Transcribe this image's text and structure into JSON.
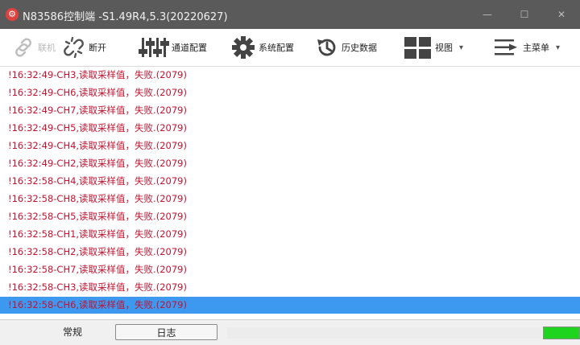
{
  "window": {
    "title": "N83586控制端 -S1.49R4,5.3(20220627)",
    "app_icon": "app-logo-icon",
    "controls": [
      "minimize-icon",
      "maximize-icon",
      "close-icon"
    ]
  },
  "toolbar": {
    "items": [
      {
        "label": "联机",
        "icon": "link-icon",
        "enabled": false
      },
      {
        "label": "断开",
        "icon": "disconnect-icon",
        "enabled": true
      },
      {
        "label": "通道配置",
        "icon": "channel-sliders-icon",
        "enabled": true
      },
      {
        "label": "系统配置",
        "icon": "gear-icon",
        "enabled": true
      },
      {
        "label": "历史数据",
        "icon": "history-clock-icon",
        "enabled": true
      },
      {
        "label": "视图",
        "icon": "grid-view-icon",
        "enabled": true,
        "dropdown": true
      },
      {
        "label": "主菜单",
        "icon": "main-menu-icon",
        "enabled": true,
        "dropdown": true
      }
    ]
  },
  "log": {
    "entries": [
      "!16:32:49-CH3,读取采样值，失败.(2079)",
      "!16:32:49-CH6,读取采样值，失败.(2079)",
      "!16:32:49-CH7,读取采样值，失败.(2079)",
      "!16:32:49-CH5,读取采样值，失败.(2079)",
      "!16:32:49-CH4,读取采样值，失败.(2079)",
      "!16:32:49-CH2,读取采样值，失败.(2079)",
      "!16:32:58-CH4,读取采样值，失败.(2079)",
      "!16:32:58-CH8,读取采样值，失败.(2079)",
      "!16:32:58-CH5,读取采样值，失败.(2079)",
      "!16:32:58-CH1,读取采样值，失败.(2079)",
      "!16:32:58-CH2,读取采样值，失败.(2079)",
      "!16:32:58-CH7,读取采样值，失败.(2079)",
      "!16:32:58-CH3,读取采样值，失败.(2079)",
      "!16:32:58-CH6,读取采样值，失败.(2079)"
    ],
    "selected_index": 13,
    "text_color": "#c4122f",
    "selection_color": "#3d99f0"
  },
  "statusbar": {
    "tabs": [
      {
        "label": "常规",
        "active": false
      },
      {
        "label": "日志",
        "active": true
      }
    ],
    "indicator_color": "#1ed41e",
    "indicator_level": 1.0
  }
}
